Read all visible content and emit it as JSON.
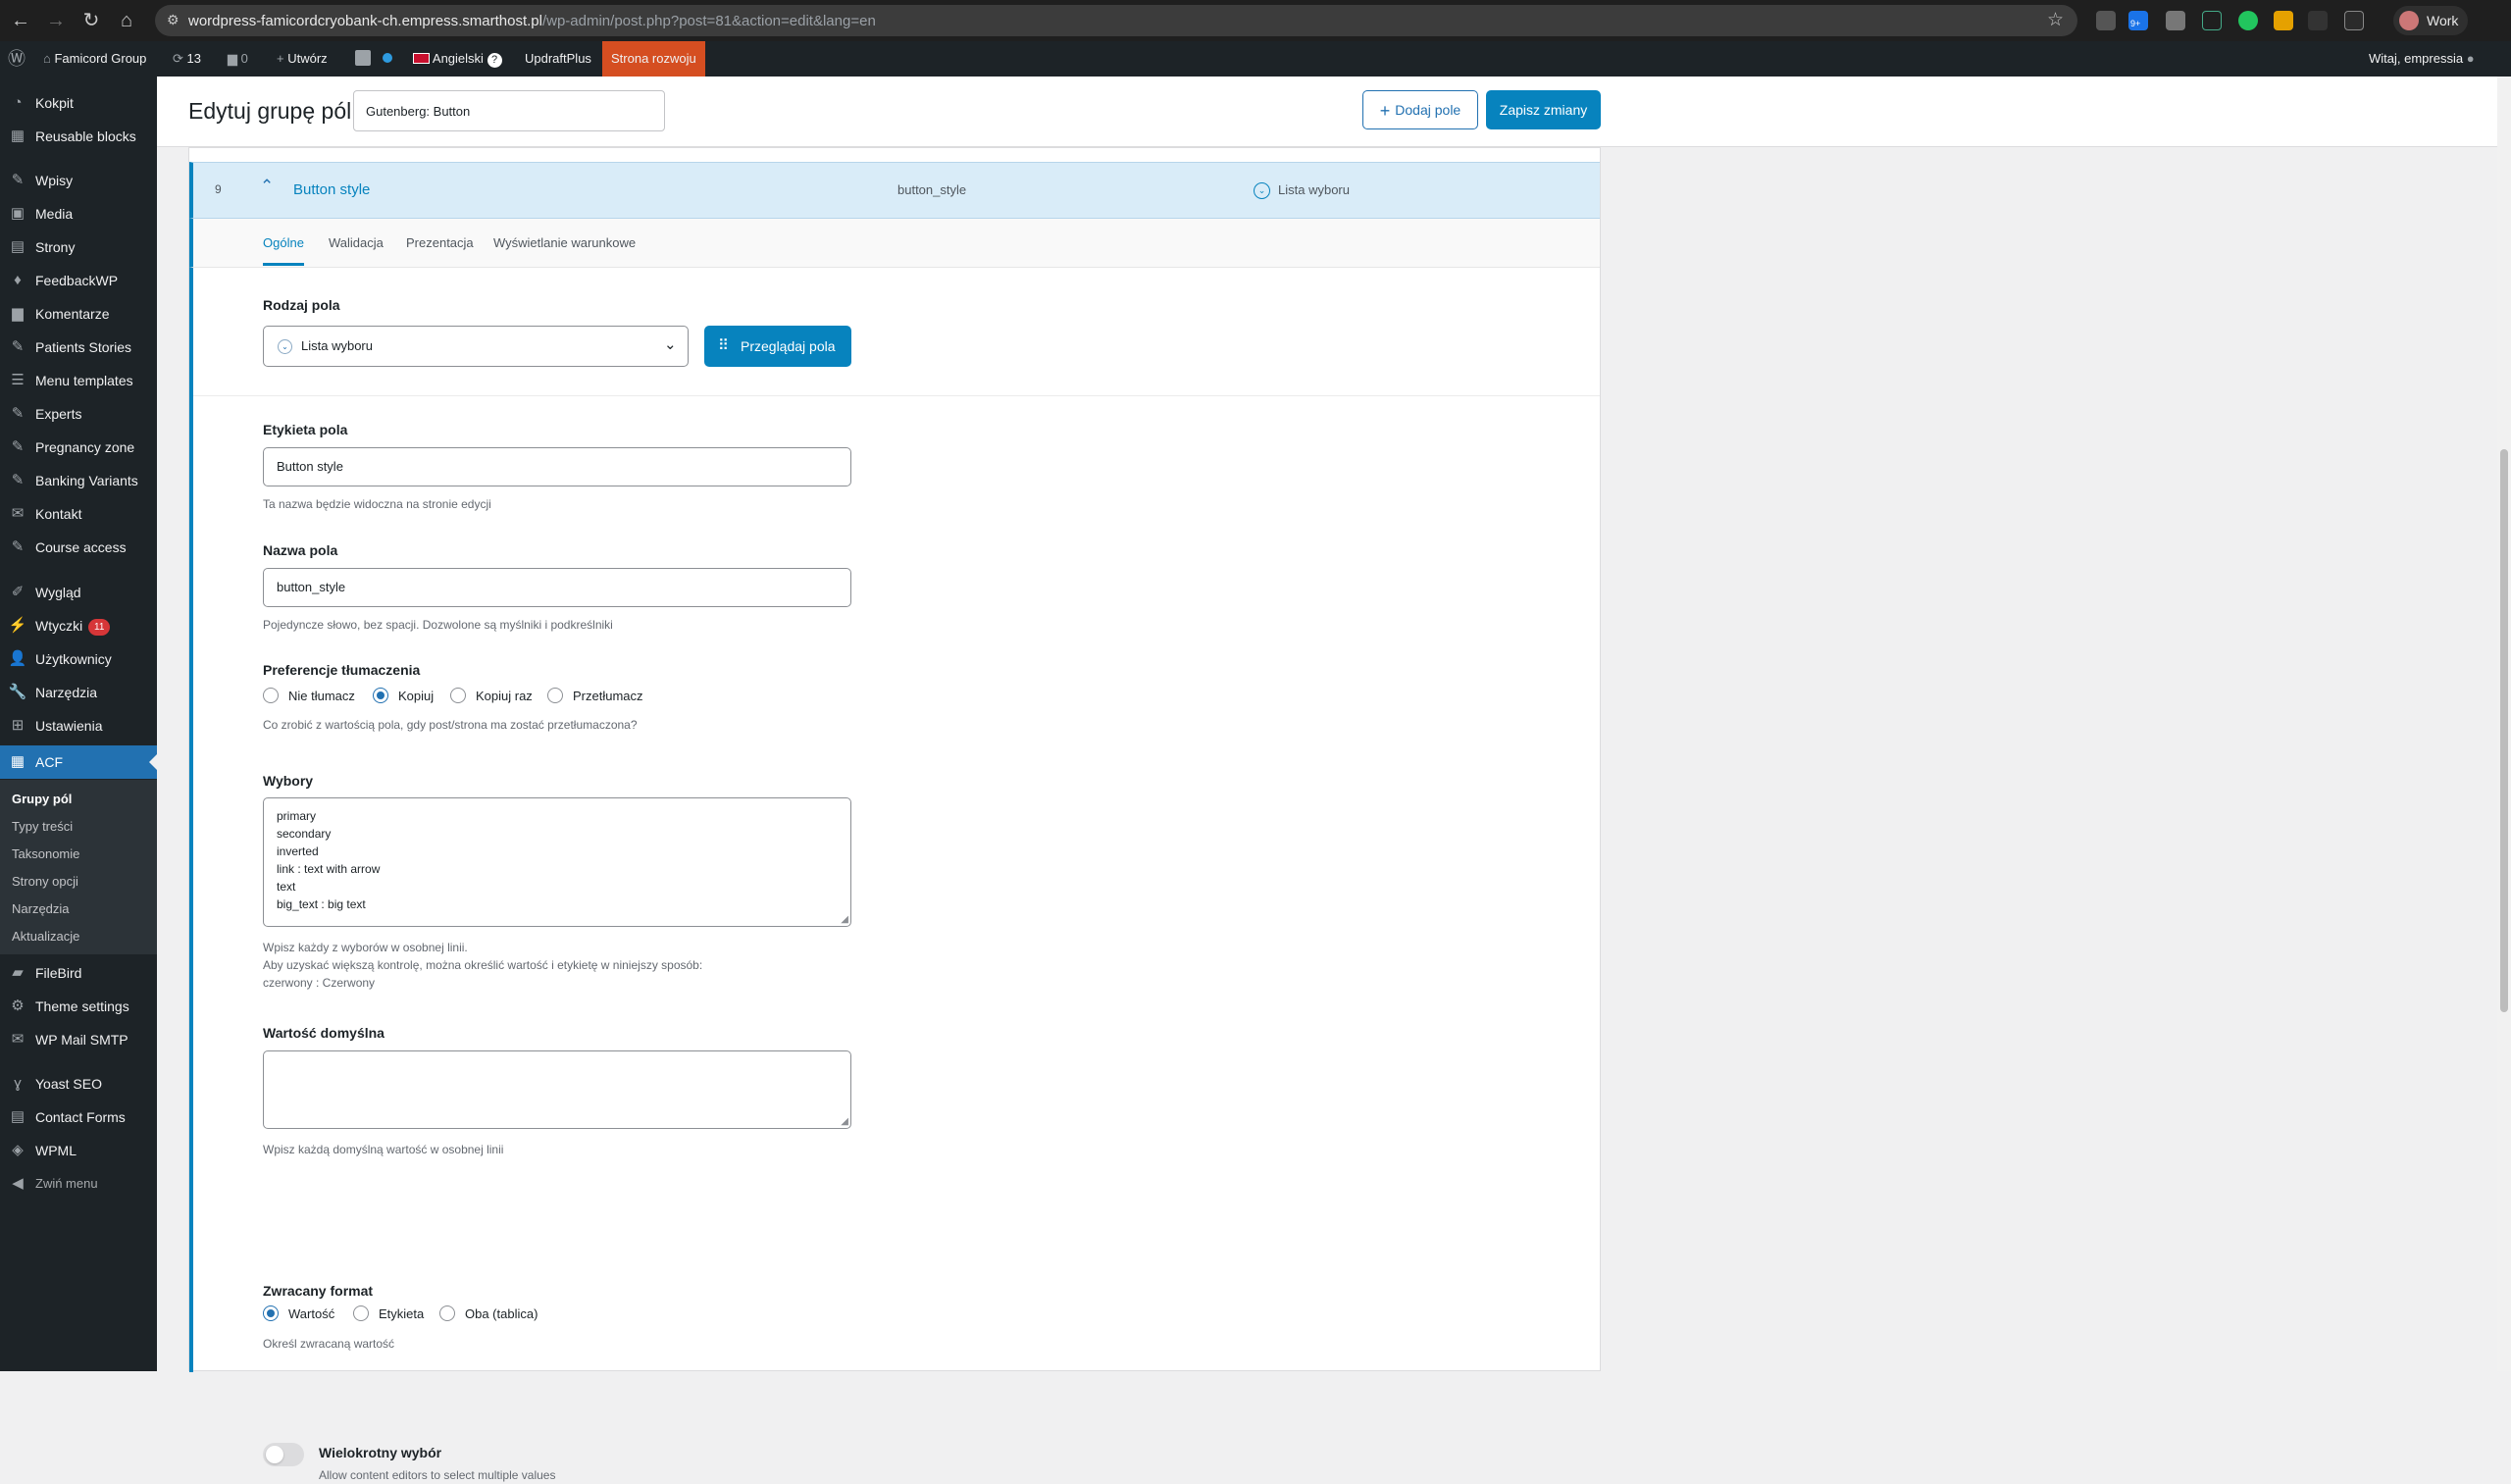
{
  "browser": {
    "url_host": "wordpress-famicordcryobank-ch.empress.smarthost.pl",
    "url_path": "/wp-admin/post.php?post=81&action=edit&lang=en",
    "profile_name": "Work",
    "extension_badge": "9+"
  },
  "adminbar": {
    "site_name": "Famicord Group",
    "updates_count": "13",
    "comments_count": "0",
    "new_label": "Utwórz",
    "language": "Angielski",
    "updraft": "UpdraftPlus",
    "env_label": "Strona rozwoju",
    "greeting": "Witaj, empressia"
  },
  "sidebar": {
    "items": [
      {
        "label": "Kokpit",
        "icon": "dashboard-icon"
      },
      {
        "label": "Reusable blocks",
        "icon": "blocks-icon"
      },
      {
        "label": "Wpisy",
        "icon": "pin-icon"
      },
      {
        "label": "Media",
        "icon": "media-icon"
      },
      {
        "label": "Strony",
        "icon": "page-icon"
      },
      {
        "label": "FeedbackWP",
        "icon": "thumbs-icon"
      },
      {
        "label": "Komentarze",
        "icon": "comment-icon"
      },
      {
        "label": "Patients Stories",
        "icon": "post-icon"
      },
      {
        "label": "Menu templates",
        "icon": "menu-icon"
      },
      {
        "label": "Experts",
        "icon": "post-icon"
      },
      {
        "label": "Pregnancy zone",
        "icon": "post-icon"
      },
      {
        "label": "Banking Variants",
        "icon": "post-icon"
      },
      {
        "label": "Kontakt",
        "icon": "mail-icon"
      },
      {
        "label": "Course access",
        "icon": "post-icon"
      },
      {
        "label": "Wygląd",
        "icon": "brush-icon"
      },
      {
        "label": "Wtyczki",
        "icon": "plugin-icon",
        "badge": "11"
      },
      {
        "label": "Użytkownicy",
        "icon": "users-icon"
      },
      {
        "label": "Narzędzia",
        "icon": "tools-icon"
      },
      {
        "label": "Ustawienia",
        "icon": "settings-icon"
      },
      {
        "label": "ACF",
        "icon": "acf-icon"
      },
      {
        "label": "FileBird",
        "icon": "folder-icon"
      },
      {
        "label": "Theme settings",
        "icon": "gear-icon"
      },
      {
        "label": "WP Mail SMTP",
        "icon": "mail-icon"
      },
      {
        "label": "Yoast SEO",
        "icon": "yoast-icon"
      },
      {
        "label": "Contact Forms",
        "icon": "form-icon"
      },
      {
        "label": "WPML",
        "icon": "wpml-icon"
      },
      {
        "label": "Zwiń menu",
        "icon": "collapse-icon"
      }
    ],
    "submenu": [
      "Grupy pól",
      "Typy treści",
      "Taksonomie",
      "Strony opcji",
      "Narzędzia",
      "Aktualizacje"
    ]
  },
  "header": {
    "page_title": "Edytuj grupę pól",
    "group_title": "Gutenberg: Button",
    "add_field": "Dodaj pole",
    "save": "Zapisz zmiany"
  },
  "field": {
    "order": "9",
    "label": "Button style",
    "name": "button_style",
    "type": "Lista wyboru"
  },
  "tabs": [
    "Ogólne",
    "Walidacja",
    "Prezentacja",
    "Wyświetlanie warunkowe"
  ],
  "settings": {
    "field_type_label": "Rodzaj pola",
    "field_type_value": "Lista wyboru",
    "browse_label": "Przeglądaj pola",
    "field_label_label": "Etykieta pola",
    "field_label_value": "Button style",
    "field_label_hint": "Ta nazwa będzie widoczna na stronie edycji",
    "field_name_label": "Nazwa pola",
    "field_name_value": "button_style",
    "field_name_hint": "Pojedyncze słowo, bez spacji. Dozwolone są myślniki i podkreślniki",
    "translation_label": "Preferencje tłumaczenia",
    "translation_options": [
      "Nie tłumacz",
      "Kopiuj",
      "Kopiuj raz",
      "Przetłumacz"
    ],
    "translation_selected": "Kopiuj",
    "translation_hint": "Co zrobić z wartością pola, gdy post/strona ma zostać przetłumaczona?",
    "choices_label": "Wybory",
    "choices": [
      "primary",
      "secondary",
      "inverted",
      "link : text with arrow",
      "text",
      "big_text : big text"
    ],
    "choices_hint_1": "Wpisz każdy z wyborów w osobnej linii.",
    "choices_hint_2": "Aby uzyskać większą kontrolę, można określić wartość i etykietę w niniejszy sposób:",
    "choices_hint_3": "czerwony : Czerwony",
    "default_label": "Wartość domyślna",
    "default_value": "",
    "default_hint": "Wpisz każdą domyślną wartość w osobnej linii",
    "return_label": "Zwracany format",
    "return_options": [
      "Wartość",
      "Etykieta",
      "Oba (tablica)"
    ],
    "return_selected": "Wartość",
    "return_hint": "Określ zwracaną wartość",
    "multiple_label": "Wielokrotny wybór",
    "multiple_hint": "Allow content editors to select multiple values",
    "multiple_enabled": false
  },
  "colors": {
    "wp_dark": "#1d2327",
    "accent": "#2271b1",
    "acf_blue": "#0783be",
    "dev_badge": "#d54e21",
    "row_highlight": "#d9ecf8"
  }
}
